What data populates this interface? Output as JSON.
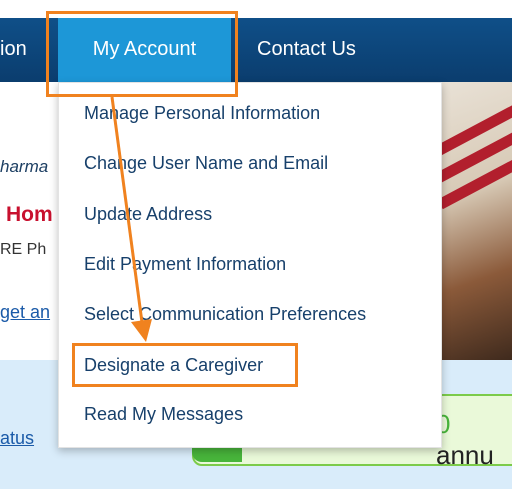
{
  "nav": {
    "partial_item": "ion",
    "my_account": "My Account",
    "contact_us": "Contact Us"
  },
  "background": {
    "italic_text": "harma",
    "home_text": "Hom",
    "care_text": "RE Ph",
    "link_text": "get an",
    "status_link": "atus",
    "counter_digit": "0",
    "counter_suffix": "annu"
  },
  "dropdown": {
    "items": [
      {
        "label": "Manage Personal Information"
      },
      {
        "label": "Change User Name and Email"
      },
      {
        "label": "Update Address"
      },
      {
        "label": "Edit Payment Information"
      },
      {
        "label": "Select Communication Preferences"
      },
      {
        "label": "Designate a Caregiver",
        "highlighted": true
      },
      {
        "label": "Read My Messages"
      }
    ]
  },
  "colors": {
    "nav_bg": "#0f4f88",
    "active_tab": "#1d97d7",
    "highlight": "#f0821f",
    "menu_text": "#17406b"
  }
}
